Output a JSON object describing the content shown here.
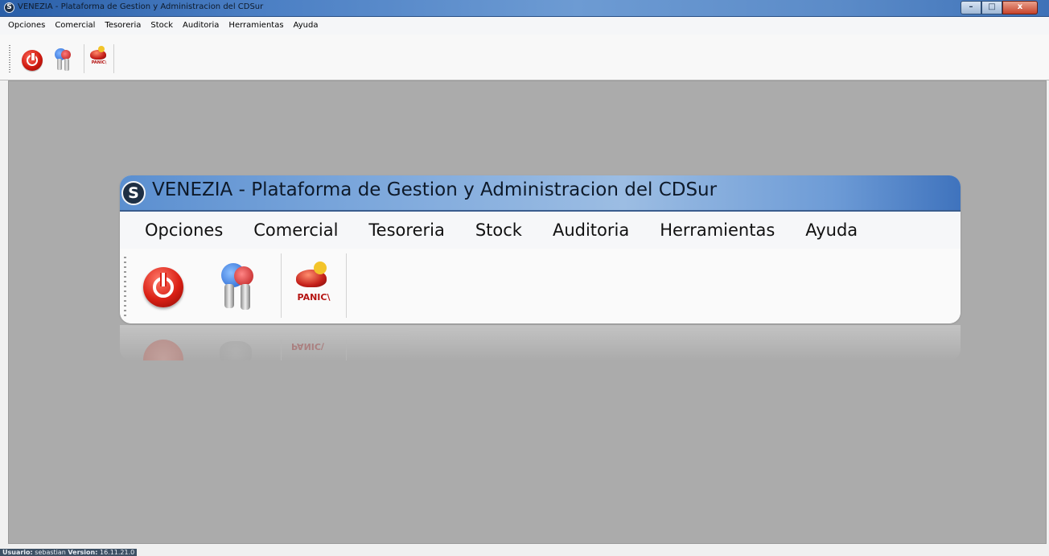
{
  "window": {
    "title": "VENEZIA - Plataforma de Gestion y Administracion del CDSur",
    "logo_glyph": "S",
    "buttons": {
      "minimize": "–",
      "maximize": "□",
      "close": "x"
    }
  },
  "menu": [
    "Opciones",
    "Comercial",
    "Tesoreria",
    "Stock",
    "Auditoria",
    "Herramientas",
    "Ayuda"
  ],
  "toolbar": {
    "buttons": [
      {
        "name": "power-button",
        "icon": "power-icon"
      },
      {
        "name": "keys-button",
        "icon": "keys-icon"
      },
      {
        "name": "panic-button",
        "icon": "panic-icon",
        "label": "PANIC\\"
      }
    ]
  },
  "splash": {
    "title": "VENEZIA - Plataforma de Gestion y Administracion del CDSur",
    "menu": [
      "Opciones",
      "Comercial",
      "Tesoreria",
      "Stock",
      "Auditoria",
      "Herramientas",
      "Ayuda"
    ],
    "panic_label": "PANIC\\",
    "reflection_label": "PANIC\\"
  },
  "status": {
    "user_label": "Usuario:",
    "user_value": "sebastian",
    "version_label": "Version:",
    "version_value": "16.11.21.0"
  },
  "colors": {
    "workspace": "#ababab",
    "titlebar_start": "#2a5fa8",
    "titlebar_end": "#3e72b8",
    "accent_red": "#d01a10"
  }
}
